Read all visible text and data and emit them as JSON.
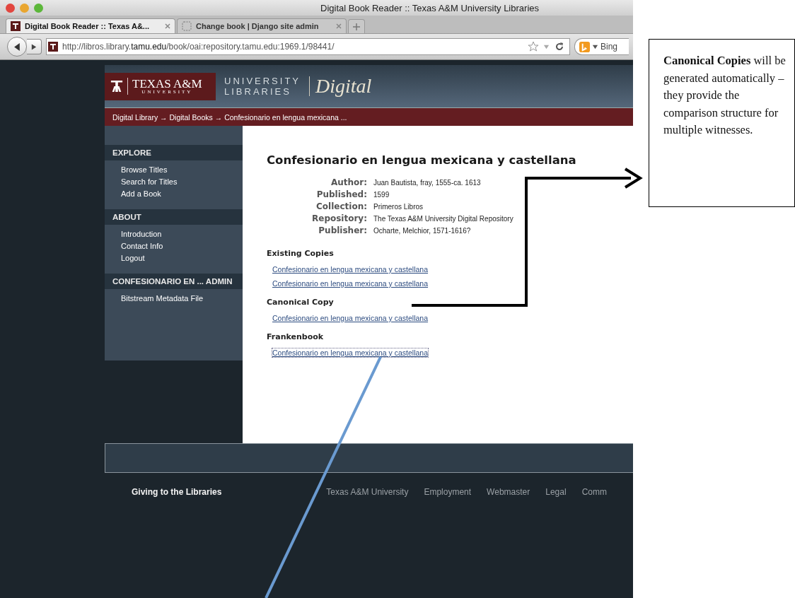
{
  "browser": {
    "title": "Digital Book Reader :: Texas A&M University Libraries",
    "tabs": [
      {
        "label": "Digital Book Reader :: Texas A&...",
        "selected": true
      },
      {
        "label": "Change book | Django site admin",
        "selected": false
      }
    ],
    "url": "http://libros.library.**tamu.edu**/book/oai:repository.tamu.edu:1969.1/98441/",
    "search_placeholder": "Bing"
  },
  "site": {
    "logo": {
      "wordmark": "TEXAS A&M",
      "sub": "UNIVERSITY",
      "line1": "UNIVERSITY",
      "line2": "LIBRARIES",
      "digital": "Digital"
    },
    "breadcrumb": "Digital Library → Digital Books → Confesionario en lengua mexicana ...",
    "sidebar": [
      {
        "heading": "EXPLORE",
        "items": [
          "Browse Titles",
          "Search for Titles",
          "Add a Book"
        ]
      },
      {
        "heading": "ABOUT",
        "items": [
          "Introduction",
          "Contact Info",
          "Logout"
        ]
      },
      {
        "heading": "CONFESIONARIO EN ... ADMIN",
        "items": [
          "Bitstream Metadata File"
        ]
      }
    ],
    "book": {
      "title": "Confesionario en lengua mexicana y castellana",
      "metadata": [
        {
          "label": "Author:",
          "value": "Juan Bautista, fray, 1555-ca. 1613"
        },
        {
          "label": "Published:",
          "value": "1599"
        },
        {
          "label": "Collection:",
          "value": "Primeros Libros"
        },
        {
          "label": "Repository:",
          "value": "The Texas A&M University Digital Repository"
        },
        {
          "label": "Publisher:",
          "value": "Ocharte, Melchior, 1571-1616?"
        }
      ],
      "sections": [
        {
          "heading": "Existing Copies",
          "links": [
            {
              "text": "Confesionario en lengua mexicana y castellana",
              "focused": false
            },
            {
              "text": "Confesionario en lengua mexicana y castellana",
              "focused": false
            }
          ]
        },
        {
          "heading": "Canonical Copy",
          "links": [
            {
              "text": "Confesionario en lengua mexicana y castellana",
              "focused": false
            }
          ]
        },
        {
          "heading": "Frankenbook",
          "links": [
            {
              "text": "Confesionario en lengua mexicana y castellana",
              "focused": true
            }
          ]
        }
      ]
    },
    "footer_links": [
      {
        "text": "Giving to the Libraries",
        "emphasized": true
      },
      {
        "text": "Texas A&M University",
        "emphasized": false
      },
      {
        "text": "Employment",
        "emphasized": false
      },
      {
        "text": "Webmaster",
        "emphasized": false
      },
      {
        "text": "Legal",
        "emphasized": false
      },
      {
        "text": "Comm",
        "emphasized": false
      }
    ]
  },
  "annotation": "**Canonical Copies** will be generated automatically – they provide the comparison structure for multiple witnesses."
}
